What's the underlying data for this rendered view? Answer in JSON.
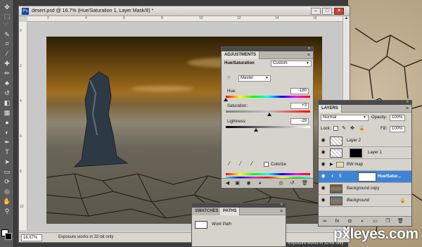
{
  "document": {
    "title": "desert.psd @ 16.7% (Hue/Saturation 1, Layer Mask/8) *",
    "ruler_h": [
      "2",
      "4",
      "6",
      "8",
      "10",
      "12",
      "14",
      "16"
    ],
    "ruler_v": [
      "0",
      "2",
      "4",
      "6",
      "8",
      "10"
    ],
    "zoom": "16.67%",
    "status": "Exposure works in 32-bit only"
  },
  "adjustments": {
    "tab": "ADJUSTMENTS",
    "preset_label": "Hue/Saturation",
    "preset_value": "Custom",
    "channel": "Master",
    "hue_label": "Hue:",
    "hue_value": "-180",
    "hue_level": 0,
    "saturation_label": "Saturation:",
    "saturation_value": "+3",
    "saturation_level": 0.515,
    "lightness_label": "Lightness:",
    "lightness_value": "-29",
    "lightness_level": 0.355,
    "colorize_label": "Colorize"
  },
  "layers": {
    "tab": "LAYERS",
    "blend_mode": "Normal",
    "opacity_label": "Opacity:",
    "opacity_value": "100%",
    "lock_label": "Lock:",
    "fill_label": "Fill:",
    "fill_value": "100%",
    "rows": [
      {
        "name": "Layer 2"
      },
      {
        "name": "Layer 1"
      },
      {
        "name": "BW map"
      },
      {
        "name": "Hue/Satur..."
      },
      {
        "name": "Background copy"
      },
      {
        "name": "Background"
      }
    ]
  },
  "paths_panel": {
    "tabs": [
      "SWATCHES",
      "PATHS"
    ],
    "path_name": "Work Path",
    "status": "Exposure works in 32-bit only"
  },
  "watermark": "pxleyes.com"
}
